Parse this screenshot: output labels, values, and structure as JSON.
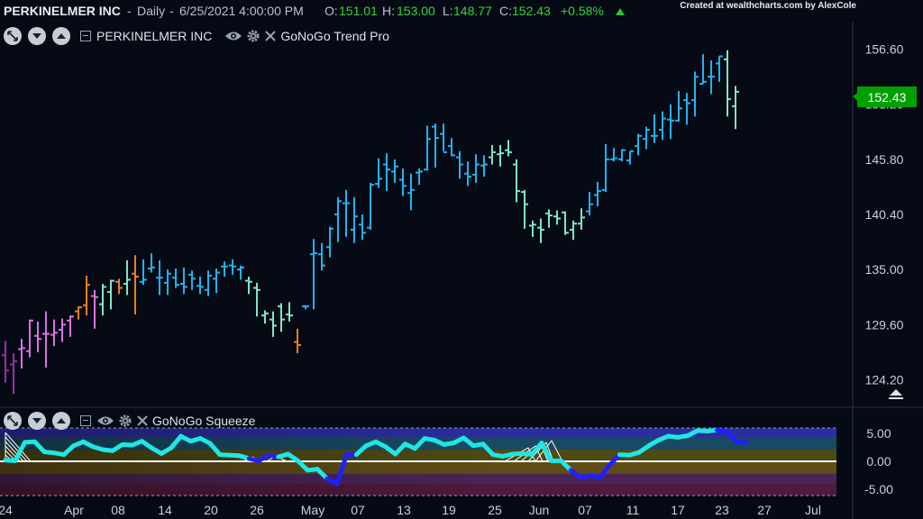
{
  "header": {
    "symbol": "PERKINELMER INC",
    "interval": "Daily",
    "datetime": "6/25/2021 4:00:00 PM",
    "open_label": "O:",
    "open": "151.01",
    "high_label": "H:",
    "high": "153.00",
    "low_label": "L:",
    "low": "148.77",
    "close_label": "C:",
    "close": "152.43",
    "change": "+0.58%",
    "change_icon": "up-triangle-icon",
    "credit": "Created at wealthcharts.com by AlexCole"
  },
  "price_pane": {
    "label": "PERKINELMER INC",
    "study": "GoNoGo Trend Pro",
    "last_price": "152.43",
    "last_price_color": "#00a000"
  },
  "squeeze_pane": {
    "study": "GoNoGo Squeeze"
  },
  "colors": {
    "background": "#060a15",
    "up_bar": "#1db4f0",
    "weak_up_bar": "#7fe6c4",
    "down_bar": "#e87e1e",
    "strong_down_bar": "#d973e0",
    "squeeze_line": "#1ee6e6",
    "squeeze_dark": "#2020ff"
  },
  "chart_data": [
    {
      "type": "ohlc",
      "title": "PERKINELMER INC - Daily",
      "yticks": [
        "156.60",
        "151.20",
        "145.80",
        "140.40",
        "135.00",
        "129.60",
        "124.20"
      ],
      "xticks": [
        "24",
        "Apr",
        "08",
        "14",
        "20",
        "26",
        "May",
        "07",
        "13",
        "19",
        "25",
        "Jun",
        "07",
        "11",
        "17",
        "23",
        "27",
        "Jul"
      ],
      "ylim": [
        121.5,
        159.3
      ],
      "bars": [
        {
          "o": 126.6,
          "h": 128.0,
          "l": 123.9,
          "c": 125.1,
          "t": "nogo_strong"
        },
        {
          "o": 125.7,
          "h": 126.8,
          "l": 122.8,
          "c": 126.0,
          "t": "nogo_strong"
        },
        {
          "o": 127.2,
          "h": 128.2,
          "l": 125.3,
          "c": 127.3,
          "t": "nogo"
        },
        {
          "o": 127.0,
          "h": 130.1,
          "l": 126.4,
          "c": 130.0,
          "t": "nogo"
        },
        {
          "o": 128.5,
          "h": 129.9,
          "l": 126.9,
          "c": 128.2,
          "t": "nogo"
        },
        {
          "o": 128.7,
          "h": 130.9,
          "l": 125.4,
          "c": 128.7,
          "t": "nogo"
        },
        {
          "o": 128.6,
          "h": 130.1,
          "l": 127.5,
          "c": 128.8,
          "t": "nogo"
        },
        {
          "o": 129.1,
          "h": 130.2,
          "l": 127.9,
          "c": 129.6,
          "t": "nogo"
        },
        {
          "o": 130.0,
          "h": 130.5,
          "l": 128.4,
          "c": 130.4,
          "t": "nogo"
        },
        {
          "o": 130.9,
          "h": 131.4,
          "l": 130.1,
          "c": 131.3,
          "t": "down"
        },
        {
          "o": 131.5,
          "h": 134.4,
          "l": 130.5,
          "c": 133.5,
          "t": "down"
        },
        {
          "o": 132.4,
          "h": 133.0,
          "l": 129.2,
          "c": 132.3,
          "t": "nogo"
        },
        {
          "o": 131.6,
          "h": 133.6,
          "l": 130.5,
          "c": 133.3,
          "t": "weak_up"
        },
        {
          "o": 132.8,
          "h": 134.0,
          "l": 131.1,
          "c": 133.9,
          "t": "weak_up"
        },
        {
          "o": 133.8,
          "h": 134.1,
          "l": 132.6,
          "c": 133.2,
          "t": "down"
        },
        {
          "o": 133.6,
          "h": 135.9,
          "l": 132.5,
          "c": 134.0,
          "t": "weak_up"
        },
        {
          "o": 134.6,
          "h": 136.4,
          "l": 130.6,
          "c": 134.3,
          "t": "down"
        },
        {
          "o": 133.8,
          "h": 136.0,
          "l": 133.5,
          "c": 134.0,
          "t": "up"
        },
        {
          "o": 135.1,
          "h": 136.6,
          "l": 134.7,
          "c": 135.2,
          "t": "up"
        },
        {
          "o": 134.2,
          "h": 135.9,
          "l": 132.5,
          "c": 134.2,
          "t": "up"
        },
        {
          "o": 133.7,
          "h": 135.0,
          "l": 132.5,
          "c": 134.6,
          "t": "up"
        },
        {
          "o": 134.2,
          "h": 135.1,
          "l": 133.2,
          "c": 133.5,
          "t": "up"
        },
        {
          "o": 133.6,
          "h": 135.2,
          "l": 132.6,
          "c": 133.3,
          "t": "up"
        },
        {
          "o": 134.5,
          "h": 134.9,
          "l": 133.0,
          "c": 134.1,
          "t": "up"
        },
        {
          "o": 133.4,
          "h": 134.3,
          "l": 132.6,
          "c": 133.3,
          "t": "up"
        },
        {
          "o": 133.0,
          "h": 134.9,
          "l": 132.4,
          "c": 134.4,
          "t": "up"
        },
        {
          "o": 134.1,
          "h": 135.1,
          "l": 132.7,
          "c": 134.7,
          "t": "up"
        },
        {
          "o": 135.3,
          "h": 135.8,
          "l": 134.3,
          "c": 135.3,
          "t": "up"
        },
        {
          "o": 135.4,
          "h": 136.0,
          "l": 134.5,
          "c": 135.3,
          "t": "up"
        },
        {
          "o": 135.0,
          "h": 135.4,
          "l": 134.0,
          "c": 135.2,
          "t": "up"
        },
        {
          "o": 133.9,
          "h": 134.3,
          "l": 132.6,
          "c": 133.8,
          "t": "weak_up"
        },
        {
          "o": 133.2,
          "h": 133.7,
          "l": 130.4,
          "c": 133.0,
          "t": "weak_up"
        },
        {
          "o": 130.5,
          "h": 131.0,
          "l": 129.7,
          "c": 130.7,
          "t": "weak_up"
        },
        {
          "o": 130.1,
          "h": 130.9,
          "l": 128.4,
          "c": 129.5,
          "t": "weak_up"
        },
        {
          "o": 131.4,
          "h": 131.7,
          "l": 128.9,
          "c": 130.1,
          "t": "weak_up"
        },
        {
          "o": 130.6,
          "h": 131.8,
          "l": 129.9,
          "c": 130.5,
          "t": "weak_up"
        },
        {
          "o": 127.9,
          "h": 129.2,
          "l": 126.8,
          "c": 127.6,
          "t": "down"
        },
        {
          "o": 131.4,
          "h": 131.5,
          "l": 131.1,
          "c": 131.4,
          "t": "up"
        },
        {
          "o": 136.5,
          "h": 138.0,
          "l": 131.1,
          "c": 136.6,
          "t": "up"
        },
        {
          "o": 136.5,
          "h": 137.6,
          "l": 134.9,
          "c": 135.4,
          "t": "up"
        },
        {
          "o": 137.2,
          "h": 139.2,
          "l": 136.2,
          "c": 139.0,
          "t": "up"
        },
        {
          "o": 140.4,
          "h": 142.1,
          "l": 137.7,
          "c": 141.7,
          "t": "up"
        },
        {
          "o": 141.5,
          "h": 142.8,
          "l": 138.2,
          "c": 141.5,
          "t": "up"
        },
        {
          "o": 138.9,
          "h": 142.1,
          "l": 137.6,
          "c": 140.2,
          "t": "up"
        },
        {
          "o": 139.4,
          "h": 140.4,
          "l": 137.9,
          "c": 138.6,
          "t": "up"
        },
        {
          "o": 139.1,
          "h": 143.5,
          "l": 138.9,
          "c": 143.3,
          "t": "up"
        },
        {
          "o": 143.4,
          "h": 145.9,
          "l": 143.0,
          "c": 143.9,
          "t": "up"
        },
        {
          "o": 145.3,
          "h": 146.4,
          "l": 142.7,
          "c": 144.8,
          "t": "up"
        },
        {
          "o": 144.6,
          "h": 145.8,
          "l": 143.5,
          "c": 145.1,
          "t": "up"
        },
        {
          "o": 143.8,
          "h": 144.9,
          "l": 142.2,
          "c": 143.2,
          "t": "up"
        },
        {
          "o": 142.5,
          "h": 144.4,
          "l": 140.8,
          "c": 142.8,
          "t": "up"
        },
        {
          "o": 144.5,
          "h": 144.9,
          "l": 143.3,
          "c": 144.6,
          "t": "up"
        },
        {
          "o": 144.8,
          "h": 149.1,
          "l": 144.7,
          "c": 147.8,
          "t": "up"
        },
        {
          "o": 149.0,
          "h": 149.3,
          "l": 145.0,
          "c": 147.9,
          "t": "up"
        },
        {
          "o": 148.3,
          "h": 149.3,
          "l": 146.6,
          "c": 146.5,
          "t": "up"
        },
        {
          "o": 147.1,
          "h": 147.9,
          "l": 146.1,
          "c": 146.2,
          "t": "up"
        },
        {
          "o": 146.0,
          "h": 146.6,
          "l": 143.9,
          "c": 145.3,
          "t": "up"
        },
        {
          "o": 144.4,
          "h": 145.6,
          "l": 143.2,
          "c": 144.1,
          "t": "up"
        },
        {
          "o": 144.3,
          "h": 146.3,
          "l": 143.5,
          "c": 145.3,
          "t": "up"
        },
        {
          "o": 145.2,
          "h": 146.2,
          "l": 144.1,
          "c": 145.3,
          "t": "up"
        },
        {
          "o": 146.0,
          "h": 147.2,
          "l": 145.3,
          "c": 146.5,
          "t": "weak_up"
        },
        {
          "o": 146.3,
          "h": 147.2,
          "l": 145.1,
          "c": 146.4,
          "t": "weak_up"
        },
        {
          "o": 146.7,
          "h": 147.7,
          "l": 146.1,
          "c": 146.5,
          "t": "weak_up"
        },
        {
          "o": 145.3,
          "h": 145.8,
          "l": 141.6,
          "c": 142.7,
          "t": "weak_up"
        },
        {
          "o": 142.6,
          "h": 142.8,
          "l": 139.0,
          "c": 141.4,
          "t": "weak_up"
        },
        {
          "o": 139.3,
          "h": 139.8,
          "l": 138.2,
          "c": 139.4,
          "t": "weak_up"
        },
        {
          "o": 139.1,
          "h": 140.0,
          "l": 137.6,
          "c": 138.9,
          "t": "weak_up"
        },
        {
          "o": 140.5,
          "h": 140.9,
          "l": 139.1,
          "c": 140.3,
          "t": "weak_up"
        },
        {
          "o": 140.2,
          "h": 140.8,
          "l": 139.4,
          "c": 140.0,
          "t": "weak_up"
        },
        {
          "o": 140.6,
          "h": 140.7,
          "l": 138.4,
          "c": 138.6,
          "t": "weak_up"
        },
        {
          "o": 138.9,
          "h": 139.8,
          "l": 137.9,
          "c": 139.5,
          "t": "weak_up"
        },
        {
          "o": 139.5,
          "h": 141.0,
          "l": 138.9,
          "c": 140.1,
          "t": "weak_up"
        },
        {
          "o": 140.7,
          "h": 142.6,
          "l": 140.3,
          "c": 141.4,
          "t": "up"
        },
        {
          "o": 142.3,
          "h": 143.6,
          "l": 141.2,
          "c": 142.7,
          "t": "up"
        },
        {
          "o": 142.8,
          "h": 147.3,
          "l": 142.6,
          "c": 145.8,
          "t": "up"
        },
        {
          "o": 145.8,
          "h": 146.9,
          "l": 145.6,
          "c": 145.9,
          "t": "up"
        },
        {
          "o": 145.8,
          "h": 146.8,
          "l": 145.6,
          "c": 146.7,
          "t": "up"
        },
        {
          "o": 145.7,
          "h": 146.6,
          "l": 145.3,
          "c": 146.6,
          "t": "up"
        },
        {
          "o": 147.1,
          "h": 148.3,
          "l": 146.2,
          "c": 148.1,
          "t": "up"
        },
        {
          "o": 147.8,
          "h": 149.0,
          "l": 146.8,
          "c": 148.7,
          "t": "up"
        },
        {
          "o": 148.1,
          "h": 150.2,
          "l": 147.4,
          "c": 148.1,
          "t": "up"
        },
        {
          "o": 148.7,
          "h": 150.5,
          "l": 147.7,
          "c": 149.8,
          "t": "up"
        },
        {
          "o": 149.7,
          "h": 151.2,
          "l": 147.8,
          "c": 149.6,
          "t": "up"
        },
        {
          "o": 149.6,
          "h": 152.5,
          "l": 149.5,
          "c": 150.8,
          "t": "up"
        },
        {
          "o": 151.6,
          "h": 152.3,
          "l": 149.2,
          "c": 151.3,
          "t": "up"
        },
        {
          "o": 151.6,
          "h": 154.4,
          "l": 150.0,
          "c": 153.9,
          "t": "up"
        },
        {
          "o": 153.2,
          "h": 156.1,
          "l": 153.2,
          "c": 153.4,
          "t": "up"
        },
        {
          "o": 153.9,
          "h": 155.5,
          "l": 152.2,
          "c": 153.9,
          "t": "up"
        },
        {
          "o": 155.2,
          "h": 155.9,
          "l": 153.4,
          "c": 155.9,
          "t": "up"
        },
        {
          "o": 155.6,
          "h": 156.5,
          "l": 150.0,
          "c": 151.7,
          "t": "weak_up"
        },
        {
          "o": 151.01,
          "h": 153.0,
          "l": 148.77,
          "c": 152.43,
          "t": "weak_up"
        }
      ]
    },
    {
      "type": "line",
      "title": "GoNoGo Squeeze",
      "yticks": [
        "5.00",
        "0.00",
        "-5.00"
      ],
      "ylim": [
        -6.5,
        7.0
      ],
      "series": [
        {
          "values": [
            0.2,
            0.1,
            3.4,
            3.5,
            1.7,
            1.5,
            1.2,
            2.8,
            3.5,
            2.6,
            2.1,
            1.9,
            3.0,
            2.9,
            3.6,
            2.4,
            1.4,
            2.4,
            4.5,
            3.6,
            4.1,
            3.2,
            1.2,
            1.1,
            1.0,
            0.5,
            0.1,
            1.1,
            0.8,
            1.3,
            0.1,
            -1.6,
            -1.4,
            -3.1,
            -4.1,
            1.2,
            1.2,
            2.8,
            3.5,
            2.6,
            1.3,
            3.1,
            2.3,
            4.1,
            3.8,
            3.0,
            3.3,
            4.2,
            2.8,
            3.1,
            1.2,
            0.9,
            1.3,
            1.4,
            1.2,
            3.3,
            0.1,
            0.1,
            -1.6,
            -2.9,
            -2.5,
            -2.9,
            -0.6,
            1.2,
            1.1,
            1.6,
            2.8,
            3.8,
            4.5,
            4.3,
            4.6,
            5.5,
            5.4,
            5.6,
            5.4,
            3.5,
            3.4
          ]
        }
      ]
    }
  ]
}
